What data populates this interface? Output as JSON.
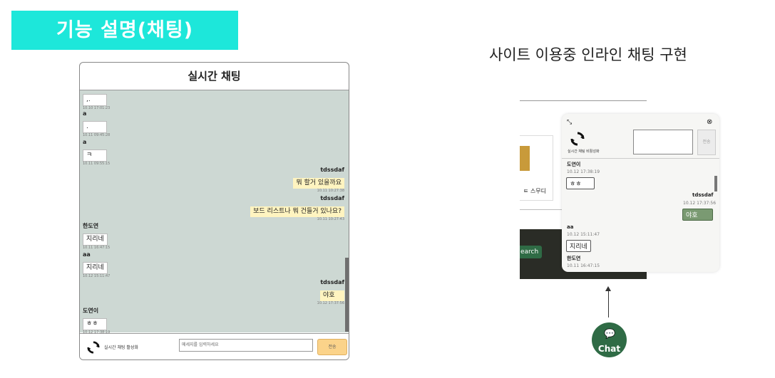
{
  "section_title": "기능 설명(채팅)",
  "description": "사이트 이용중 인라인 채팅 구현",
  "chat_panel": {
    "header": "실시간 채팅",
    "messages": [
      {
        "side": "left",
        "name": "",
        "text": ",.",
        "time": "10.10 17:01:23"
      },
      {
        "side": "left",
        "name": "a",
        "text": ".",
        "time": "10.11 09:45:28"
      },
      {
        "side": "left",
        "name": "a",
        "text": "ㅋ",
        "time": "10.11 09:55:15"
      },
      {
        "side": "right",
        "name": "tdssdaf",
        "text": "뭐 할거 있을까요",
        "time": "10.11 10:27:38"
      },
      {
        "side": "right",
        "name": "tdssdaf",
        "text": "보드 리스트나 뭐 건들거 있나요?",
        "time": "10.11 10:27:43"
      },
      {
        "side": "left",
        "name": "한도연",
        "text": "지리네",
        "time": "10.11 16:47:15"
      },
      {
        "side": "left",
        "name": "aa",
        "text": "지리네",
        "time": "10.12 15:11:47"
      },
      {
        "side": "right",
        "name": "tdssdaf",
        "text": "야호",
        "time": "10.12 17:37:56"
      },
      {
        "side": "left",
        "name": "도연이",
        "text": "ㅎㅎ",
        "time": "10.12 17:38:19"
      }
    ],
    "footer_label": "실시간 채팅 활성화",
    "input_placeholder": "메세지를 입력하세요",
    "send_label": "전송"
  },
  "widget": {
    "label": "실시간 채팅 비활성화",
    "send_label": "전송",
    "messages": [
      {
        "side": "left",
        "name": "도연이",
        "time": "10.12 17:38:19",
        "text": "ㅎㅎ"
      },
      {
        "side": "right",
        "name": "tdssdaf",
        "time": "10.12 17:37:56",
        "text": "야호"
      },
      {
        "side": "left",
        "name": "aa",
        "time": "10.12 15:11:47",
        "text": "지리네"
      },
      {
        "side": "left",
        "name": "한도연",
        "time": "10.11 16:47:15",
        "text": ""
      }
    ]
  },
  "background": {
    "card_label": "ㅌ 스무디",
    "search_label": "earch"
  },
  "fab_label": "Chat",
  "colors": {
    "accent": "#1de7da",
    "chat_bg": "#cdd8d3",
    "brand_green": "#2f6b45",
    "bubble_right": "#fff4c0",
    "send": "#fbd38a"
  }
}
